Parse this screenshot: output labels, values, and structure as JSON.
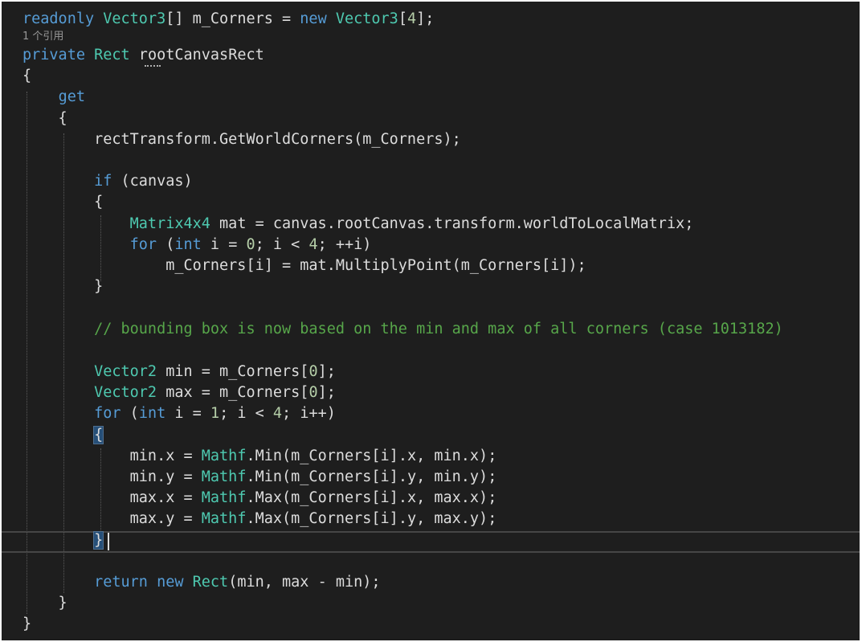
{
  "editor": {
    "codelens": "1 个引用",
    "lines": {
      "l1": {
        "t0": "readonly",
        "t1": " ",
        "t2": "Vector3",
        "t3": "[] m_Corners = ",
        "t4": "new",
        "t5": " ",
        "t6": "Vector3",
        "t7": "[",
        "t8": "4",
        "t9": "];"
      },
      "l2": {
        "t0": "private",
        "t1": " ",
        "t2": "Rect",
        "t3": " rootCanvasRect"
      },
      "l3": {
        "t0": "{"
      },
      "l4": {
        "t0": "    ",
        "t1": "get"
      },
      "l5": {
        "t0": "    {"
      },
      "l6": {
        "t0": "        rectTransform.GetWorldCorners(m_Corners);"
      },
      "l7": {
        "t0": "        ",
        "t1": "if",
        "t2": " (canvas)"
      },
      "l8": {
        "t0": "        {"
      },
      "l9": {
        "t0": "            ",
        "t1": "Matrix4x4",
        "t2": " mat = canvas.rootCanvas.transform.worldToLocalMatrix;"
      },
      "l10": {
        "t0": "            ",
        "t1": "for",
        "t2": " (",
        "t3": "int",
        "t4": " i = ",
        "t5": "0",
        "t6": "; i < ",
        "t7": "4",
        "t8": "; ++i)"
      },
      "l11": {
        "t0": "                m_Corners[i] = mat.MultiplyPoint(m_Corners[i]);"
      },
      "l12": {
        "t0": "        }"
      },
      "l13": {
        "t0": "        ",
        "t1": "// bounding box is now based on the min and max of all corners (case 1013182)"
      },
      "l14": {
        "t0": "        ",
        "t1": "Vector2",
        "t2": " min = m_Corners[",
        "t3": "0",
        "t4": "];"
      },
      "l15": {
        "t0": "        ",
        "t1": "Vector2",
        "t2": " max = m_Corners[",
        "t3": "0",
        "t4": "];"
      },
      "l16": {
        "t0": "        ",
        "t1": "for",
        "t2": " (",
        "t3": "int",
        "t4": " i = ",
        "t5": "1",
        "t6": "; i < ",
        "t7": "4",
        "t8": "; i++)"
      },
      "l17": {
        "t0": "        ",
        "t1": "{"
      },
      "l18": {
        "t0": "            min.x = ",
        "t1": "Mathf",
        "t2": ".Min(m_Corners[i].x, min.x);"
      },
      "l19": {
        "t0": "            min.y = ",
        "t1": "Mathf",
        "t2": ".Min(m_Corners[i].y, min.y);"
      },
      "l20": {
        "t0": "            max.x = ",
        "t1": "Mathf",
        "t2": ".Max(m_Corners[i].x, max.x);"
      },
      "l21": {
        "t0": "            max.y = ",
        "t1": "Mathf",
        "t2": ".Max(m_Corners[i].y, max.y);"
      },
      "l22": {
        "t0": "        ",
        "t1": "}"
      },
      "l23": {
        "t0": "        ",
        "t1": "return",
        "t2": " ",
        "t3": "new",
        "t4": " ",
        "t5": "Rect",
        "t6": "(min, max - min);"
      },
      "l24": {
        "t0": "    }"
      },
      "l25": {
        "t0": "}"
      }
    }
  },
  "colors": {
    "background": "#1e1e1e",
    "keyword": "#569cd6",
    "type": "#4ec9b0",
    "number": "#b5cea8",
    "comment": "#57a64a",
    "text": "#dcdcdc"
  }
}
